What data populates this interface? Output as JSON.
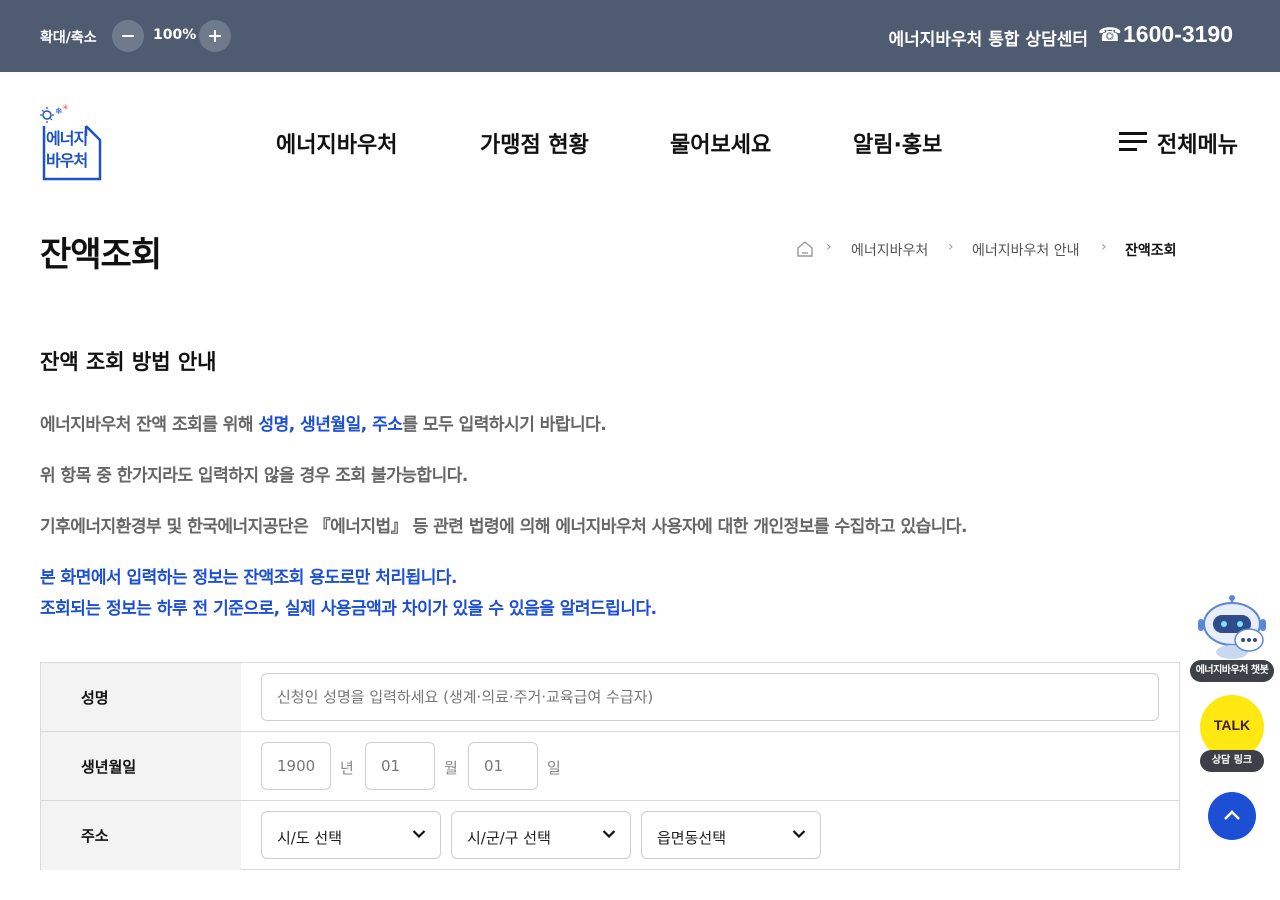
{
  "topbar": {
    "zoom_label": "확대/축소",
    "zoom_value": "100%",
    "center_label": "에너지바우처 통합 상담센터",
    "phone_icon": "☎",
    "phone_number": "1600-3190"
  },
  "header": {
    "logo_text_line1": "에너지",
    "logo_text_line2": "바우처",
    "nav": [
      "에너지바우처",
      "가맹점 현황",
      "물어보세요",
      "알림·홍보"
    ],
    "all_menu_label": "전체메뉴"
  },
  "page": {
    "title": "잔액조회",
    "breadcrumb": [
      "에너지바우처",
      "에너지바우처 안내",
      "잔액조회"
    ]
  },
  "guide": {
    "title": "잔액 조회 방법 안내",
    "p1_before": "에너지바우처 잔액 조회를 위해 ",
    "p1_highlight": "성명, 생년월일, 주소",
    "p1_after": "를 모두 입력하시기 바랍니다.",
    "p2": "위 항목 중 한가지라도 입력하지 않을 경우 조회 불가능합니다.",
    "p3": "기후에너지환경부 및 한국에너지공단은 『에너지법』 등 관련 법령에 의해 에너지바우처 사용자에 대한 개인정보를 수집하고 있습니다.",
    "p4": "본 화면에서 입력하는 정보는 잔액조회 용도로만 처리됩니다.",
    "p5": "조회되는 정보는 하루 전 기준으로, 실제 사용금액과 차이가 있을 수 있음을 알려드립니다."
  },
  "form": {
    "name_label": "성명",
    "name_placeholder": "신청인 성명을 입력하세요 (생계·의료·주거·교육급여 수급자)",
    "birth_label": "생년월일",
    "birth_year": "1900",
    "birth_year_unit": "년",
    "birth_month": "01",
    "birth_month_unit": "월",
    "birth_day": "01",
    "birth_day_unit": "일",
    "address_label": "주소",
    "sido": "시/도 선택",
    "sigungu": "시/군/구 선택",
    "eupmyeondong": "읍면동선택"
  },
  "floating": {
    "chatbot_label": "에너지바우처 챗봇",
    "talk_text": "TALK",
    "talk_label": "상담 링크"
  },
  "colors": {
    "topbar": "#4f5b70",
    "accent_blue": "#1c4fd3",
    "kakao_yellow": "#ffe812"
  }
}
